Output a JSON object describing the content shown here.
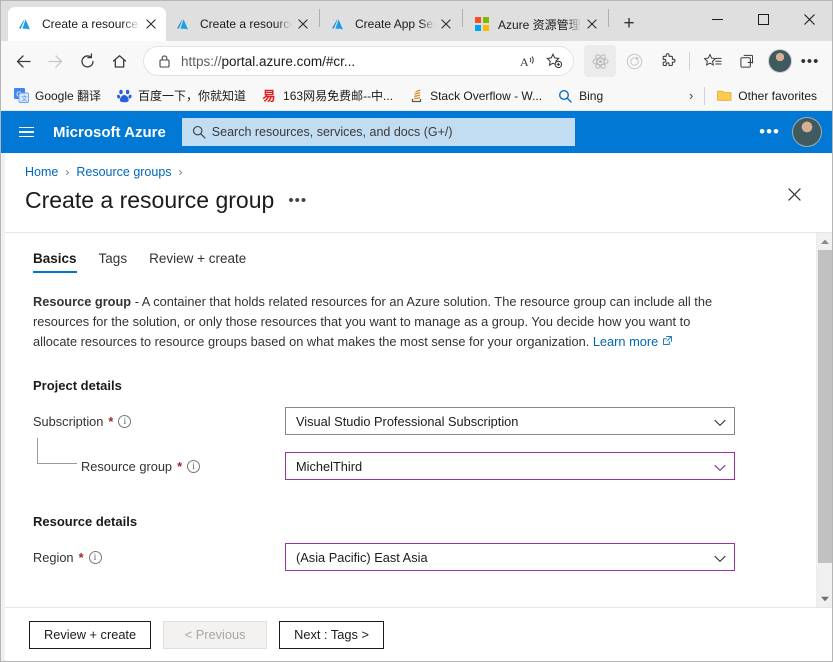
{
  "browser": {
    "tabs": [
      {
        "title": "Create a resource group",
        "favicon": "azure-icon",
        "active": true
      },
      {
        "title": "Create a resource group",
        "favicon": "azure-icon",
        "active": false
      },
      {
        "title": "Create App Service",
        "favicon": "azure-icon",
        "active": false
      },
      {
        "title": "Azure 资源管理器",
        "favicon": "microsoft-icon",
        "active": false
      }
    ],
    "new_tab_label": "+",
    "window_controls": {
      "minimize": "—",
      "maximize": "▢",
      "close": "✕"
    },
    "toolbar": {
      "back": "←",
      "forward": "→",
      "refresh": "⟳",
      "home": "⌂",
      "url_prefix": "https://",
      "url_main": "portal.azure.com/#cr...",
      "read_aloud": "A",
      "add_favorite": "favorite-star",
      "collections": "collections-icon",
      "browser_essentials": "essentials-icon",
      "extensions": "puzzle-icon",
      "favorites": "favorites-star",
      "split_screen": "split-screen-icon",
      "profile": "profile-avatar",
      "settings_more": "•••"
    },
    "bookmarks": [
      {
        "label": "Google 翻译",
        "icon": "google-translate-icon"
      },
      {
        "label": "百度一下，你就知道",
        "icon": "baidu-icon"
      },
      {
        "label": "163网易免费邮--中...",
        "icon": "netease-icon"
      },
      {
        "label": "Stack Overflow - W...",
        "icon": "stackoverflow-icon"
      },
      {
        "label": "Bing",
        "icon": "bing-search-icon"
      }
    ],
    "bookmarks_overflow": "›",
    "other_favorites": {
      "label": "Other favorites",
      "icon": "folder-icon"
    }
  },
  "azure_header": {
    "menu_icon": "hamburger-icon",
    "brand": "Microsoft Azure",
    "search_placeholder": "Search resources, services, and docs (G+/)",
    "more_label": "•••",
    "account_icon": "account-avatar"
  },
  "breadcrumb": {
    "items": [
      "Home",
      "Resource groups"
    ],
    "separator": "›"
  },
  "page": {
    "title": "Create a resource group",
    "more_actions": "•••",
    "close_label": "✕"
  },
  "form_tabs": [
    {
      "label": "Basics",
      "active": true
    },
    {
      "label": "Tags",
      "active": false
    },
    {
      "label": "Review + create",
      "active": false
    }
  ],
  "description": {
    "lead": "Resource group",
    "body": " - A container that holds related resources for an Azure solution. The resource group can include all the resources for the solution, or only those resources that you want to manage as a group. You decide how you want to allocate resources to resource groups based on what makes the most sense for your organization. ",
    "link": "Learn more",
    "link_icon": "external-link-icon"
  },
  "project_details": {
    "section_title": "Project details",
    "subscription": {
      "label": "Subscription",
      "required": "*",
      "info": "info-icon",
      "value": "Visual Studio Professional Subscription",
      "chevron": "chevron-down-icon"
    },
    "resource_group": {
      "label": "Resource group",
      "required": "*",
      "info": "info-icon",
      "value": "MichelThird",
      "chevron": "chevron-down-icon"
    }
  },
  "resource_details": {
    "section_title": "Resource details",
    "region": {
      "label": "Region",
      "required": "*",
      "info": "info-icon",
      "value": "(Asia Pacific) East Asia",
      "chevron": "chevron-down-icon"
    }
  },
  "footer": {
    "review_create": "Review + create",
    "previous": "< Previous",
    "next": "Next : Tags >"
  },
  "scrollbar": {
    "up_arrow": "▲",
    "down_arrow": "▼"
  },
  "colors": {
    "azure_blue": "#0078d4",
    "link_blue": "#0067b8",
    "required_red": "#a4262c",
    "modified_purple": "#9b2fae"
  }
}
